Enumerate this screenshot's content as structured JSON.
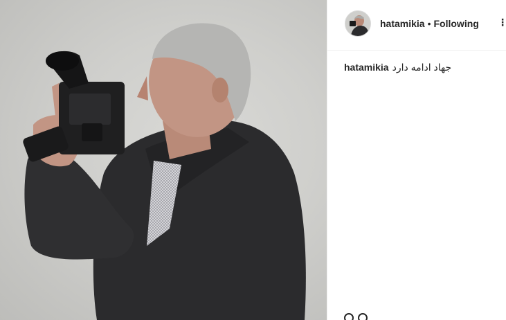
{
  "post": {
    "image_subject": "Portrait of a gray-haired man in a dark jacket holding a film camera",
    "username": "hatamikia",
    "separator": "•",
    "follow_status": "Following",
    "more_icon": "more-options-icon",
    "caption": {
      "username": "hatamikia",
      "text": "جهاد ادامه دارد"
    }
  }
}
